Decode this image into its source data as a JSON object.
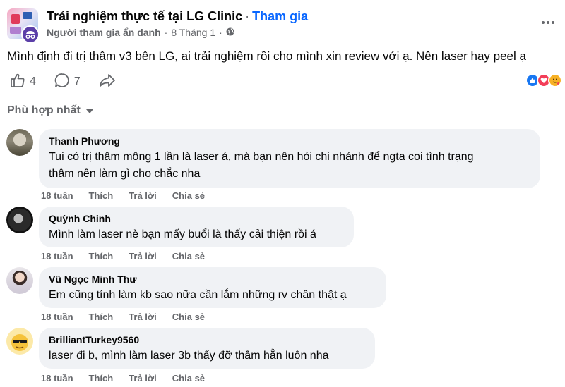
{
  "post": {
    "group_name": "Trải nghiệm thực tế tại LG Clinic",
    "join_label": "Tham gia",
    "author": "Người tham gia ẩn danh",
    "date": "8 Tháng 1",
    "text": "Mình định đi trị thâm v3 bên LG, ai trải nghiệm rồi cho mình xin review với ạ. Nên laser hay peel ạ",
    "like_count": "4",
    "comment_count": "7"
  },
  "sort_label": "Phù hợp nhất",
  "comments": [
    {
      "name": "Thanh Phương",
      "lines": [
        "Tui có trị thâm mông 1 lần là laser á, mà bạn nên hỏi chi nhánh để ngta coi tình trạng",
        "thâm nên làm gì cho chắc nha"
      ],
      "time": "18 tuần",
      "like": "Thích",
      "reply": "Trả lời",
      "share": "Chia sẻ"
    },
    {
      "name": "Quỳnh Chinh",
      "lines": [
        "Mình làm laser nè bạn mấy buổi là thấy cải thiện rồi á"
      ],
      "time": "18 tuần",
      "like": "Thích",
      "reply": "Trả lời",
      "share": "Chia sẻ"
    },
    {
      "name": "Vũ Ngọc Minh Thư",
      "lines": [
        "Em cũng tính làm kb sao nữa cần lắm những rv chân thật ạ"
      ],
      "time": "18 tuần",
      "like": "Thích",
      "reply": "Trả lời",
      "share": "Chia sẻ"
    },
    {
      "name": "BrilliantTurkey9560",
      "lines": [
        "laser đi b, mình làm laser 3b thấy đỡ thâm hẳn luôn nha"
      ],
      "time": "18 tuần",
      "like": "Thích",
      "reply": "Trả lời",
      "share": "Chia sẻ"
    }
  ],
  "colors": {
    "accent": "#0866ff",
    "meta": "#65676b",
    "bubble": "#f0f2f5",
    "like": "#1877f2",
    "love": "#f33e58",
    "care": "#f7b125"
  }
}
